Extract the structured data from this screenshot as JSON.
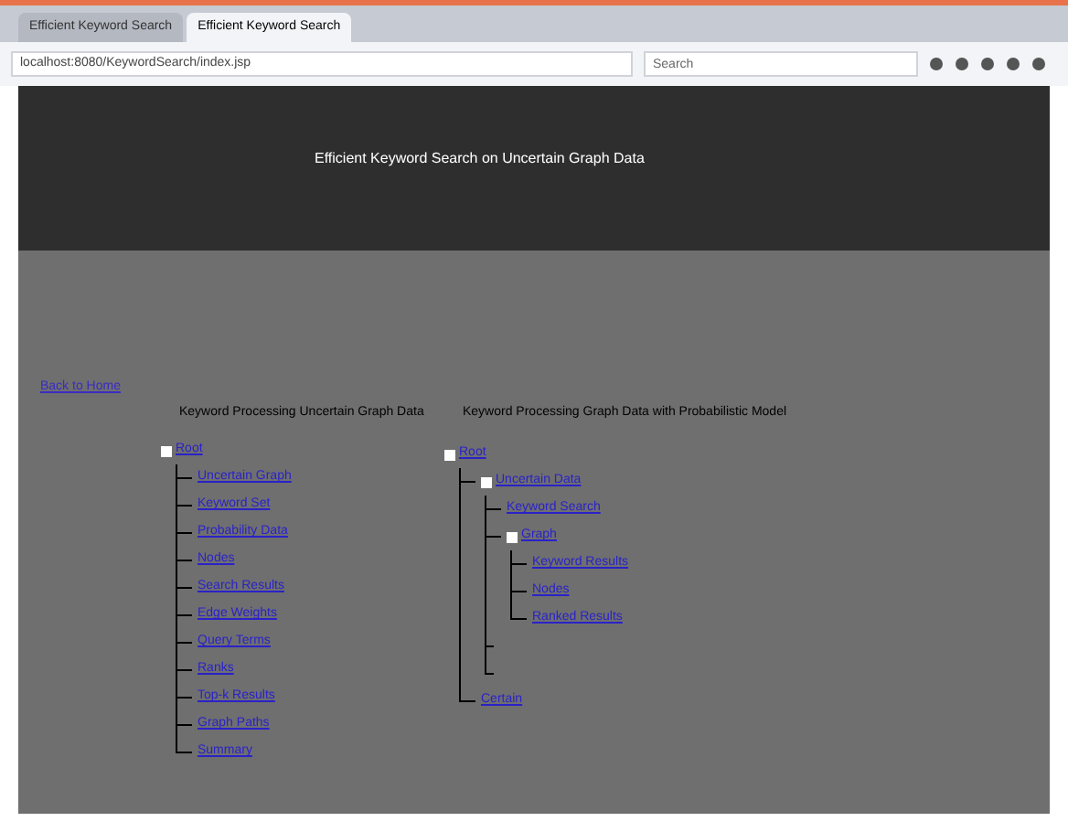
{
  "browser": {
    "tabs": [
      {
        "label": "Efficient Keyword Search",
        "selected": false
      },
      {
        "label": "Efficient Keyword Search",
        "selected": true
      }
    ],
    "address": "localhost:8080/KeywordSearch/index.jsp",
    "search": {
      "placeholder": "Search"
    }
  },
  "header": {
    "title": "Efficient Keyword Search on Uncertain Graph Data"
  },
  "back_link": "Back to Home",
  "trees": [
    {
      "title": "Keyword Processing Uncertain Graph Data",
      "root": {
        "label": "Root",
        "expanded": true,
        "children": [
          {
            "label": "Uncertain Graph"
          },
          {
            "label": "Keyword Set"
          },
          {
            "label": "Probability Data"
          },
          {
            "label": "Nodes"
          },
          {
            "label": "Search Results"
          },
          {
            "label": "Edge Weights"
          },
          {
            "label": "Query Terms"
          },
          {
            "label": "Ranks"
          },
          {
            "label": "Top-k Results"
          },
          {
            "label": "Graph Paths"
          },
          {
            "label": "Summary"
          }
        ]
      }
    },
    {
      "title": "Keyword Processing Graph Data with Probabilistic Model",
      "root": {
        "label": "Root",
        "expanded": true,
        "children": [
          {
            "label": "Uncertain Data",
            "expanded": true,
            "children": [
              {
                "label": "Keyword Search"
              },
              {
                "label": "Graph",
                "expanded": true,
                "children": [
                  {
                    "label": "Keyword Results"
                  },
                  {
                    "label": "Nodes"
                  },
                  {
                    "label": "Ranked Results"
                  }
                ]
              },
              {
                "kind": "stub"
              },
              {
                "kind": "stub"
              }
            ]
          },
          {
            "label": "Certain"
          }
        ]
      }
    }
  ]
}
